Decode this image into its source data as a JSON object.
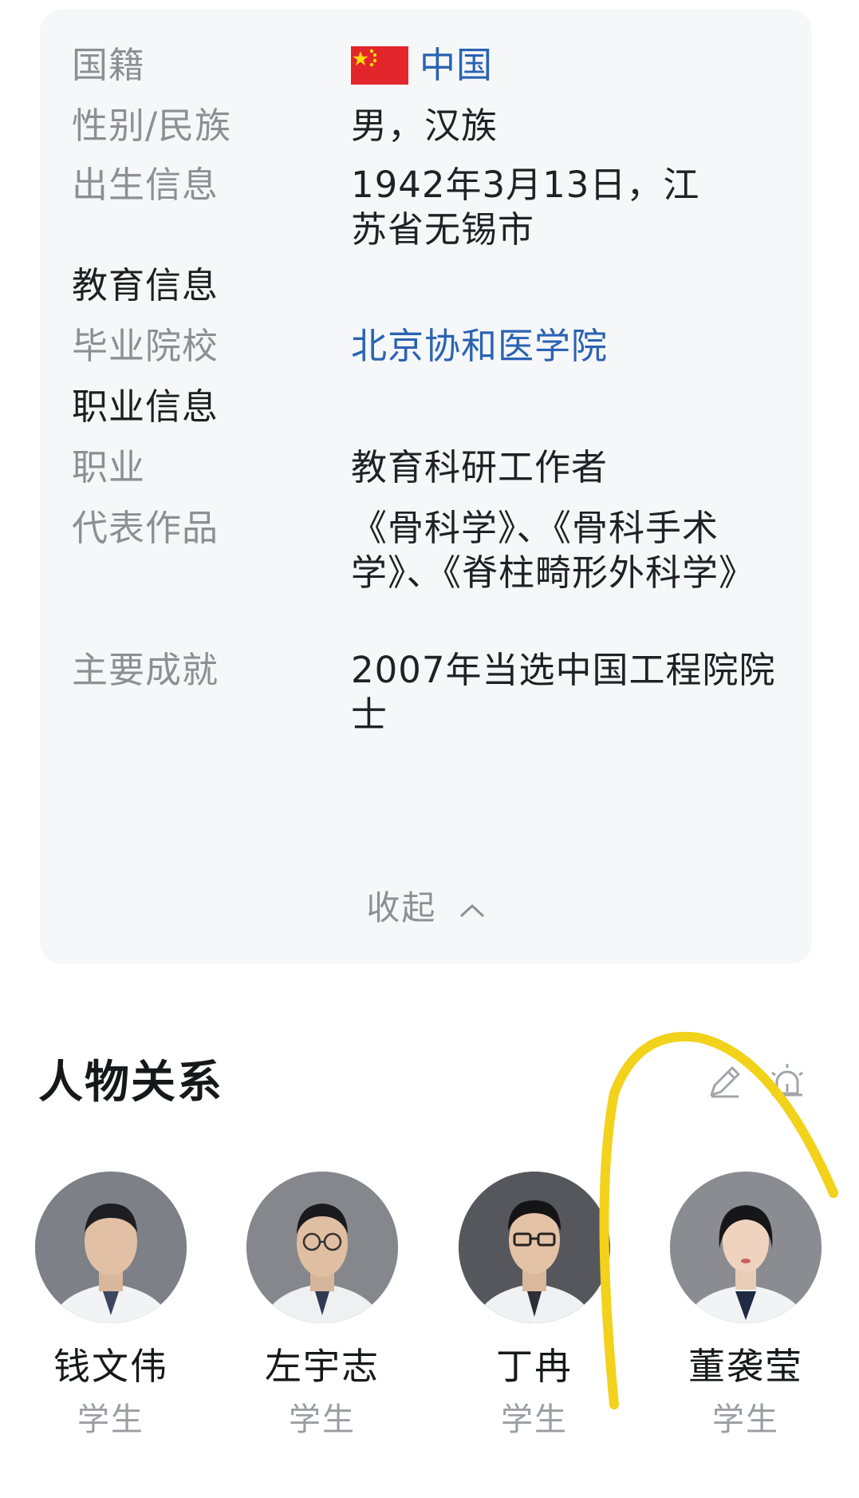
{
  "info": {
    "rows": [
      {
        "label": "国籍",
        "value": "中国"
      },
      {
        "label": "性别/民族",
        "value": "男，汉族"
      },
      {
        "label": "出生信息",
        "value": "1942年3月13日，江苏省无锡市"
      },
      {
        "label": "教育信息"
      },
      {
        "label": "毕业院校",
        "value": "北京协和医学院"
      },
      {
        "label": "职业信息"
      },
      {
        "label": "职业",
        "value": "教育科研工作者"
      },
      {
        "label": "代表作品",
        "value": "《骨科学》、《骨科手术学》、《脊柱畸形外科学》"
      },
      {
        "label": "主要成就",
        "value": "2007年当选中国工程院院士"
      }
    ],
    "collapse_label": "收起"
  },
  "relations": {
    "title": "人物关系",
    "people": [
      {
        "name": "钱文伟",
        "role": "学生"
      },
      {
        "name": "左宇志",
        "role": "学生"
      },
      {
        "name": "丁冉",
        "role": "学生"
      },
      {
        "name": "董袭莹",
        "role": "学生"
      }
    ]
  },
  "icons": {
    "edit": "edit-pencil-icon",
    "alarm": "alarm-siren-icon",
    "collapse": "chevron-up-icon",
    "flag": "china-flag-icon"
  },
  "colors": {
    "card_bg": "#f6f7f8",
    "label": "#8c8f94",
    "link": "#2a63b3",
    "highlight_scribble": "#f2d21a"
  }
}
